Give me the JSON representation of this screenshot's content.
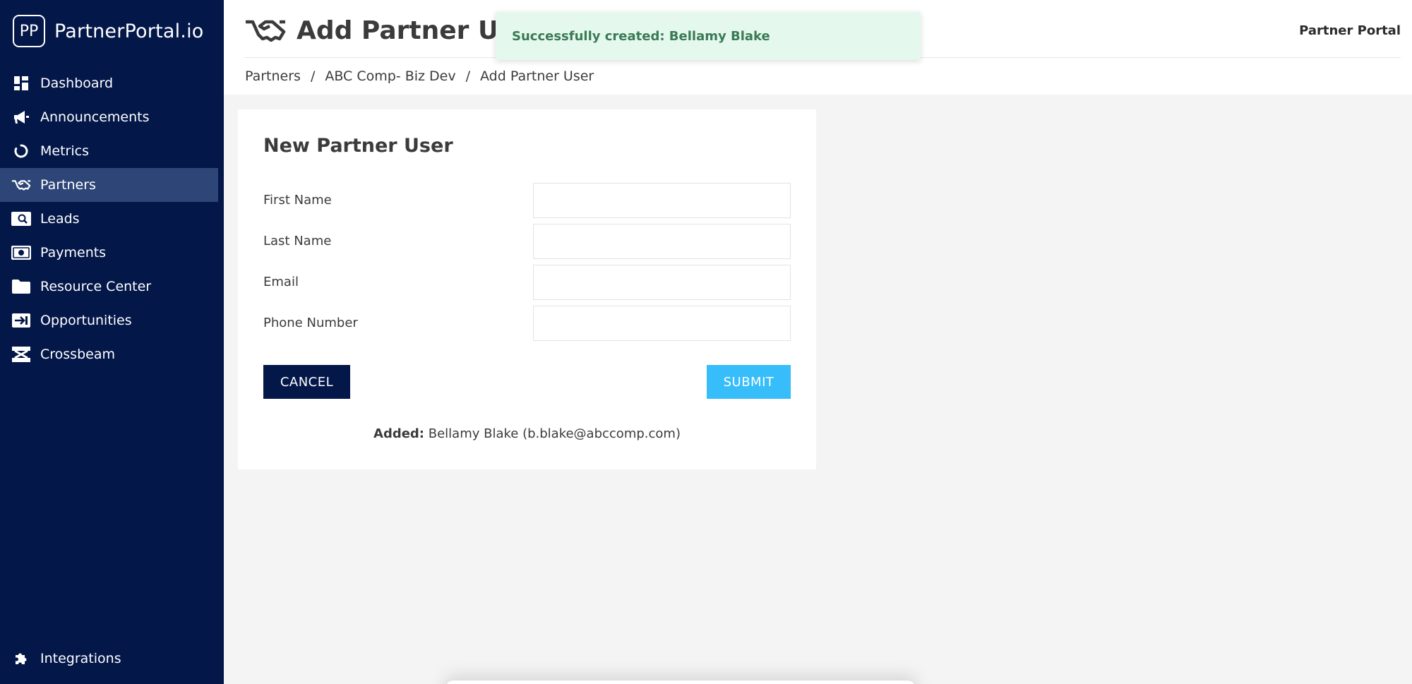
{
  "brand": {
    "logo_text": "PP",
    "name": "PartnerPortal.io"
  },
  "sidebar": {
    "items": [
      {
        "label": "Dashboard",
        "icon": "dashboard-icon"
      },
      {
        "label": "Announcements",
        "icon": "megaphone-icon"
      },
      {
        "label": "Metrics",
        "icon": "circle-notch-icon"
      },
      {
        "label": "Partners",
        "icon": "handshake-icon",
        "active": true
      },
      {
        "label": "Leads",
        "icon": "search-dollar-icon"
      },
      {
        "label": "Payments",
        "icon": "money-bill-icon"
      },
      {
        "label": "Resource Center",
        "icon": "folder-icon"
      },
      {
        "label": "Opportunities",
        "icon": "arrow-in-box-icon"
      },
      {
        "label": "Crossbeam",
        "icon": "crossbeam-icon"
      }
    ],
    "bottom_item": {
      "label": "Integrations",
      "icon": "puzzle-icon"
    }
  },
  "header": {
    "title": "Add Partner User",
    "title_icon": "handshake-icon",
    "right_label": "Partner Portal",
    "breadcrumb": [
      "Partners",
      "ABC Comp- Biz Dev",
      "Add Partner User"
    ],
    "breadcrumb_separator": "/"
  },
  "toast": {
    "message": "Successfully created: Bellamy Blake"
  },
  "form": {
    "title": "New Partner User",
    "fields": [
      {
        "label": "First Name",
        "value": "",
        "placeholder": ""
      },
      {
        "label": "Last Name",
        "value": "",
        "placeholder": ""
      },
      {
        "label": "Email",
        "value": "",
        "placeholder": ""
      },
      {
        "label": "Phone Number",
        "value": "",
        "placeholder": ""
      }
    ],
    "cancel_label": "CANCEL",
    "submit_label": "SUBMIT",
    "added_prefix": "Added:",
    "added_text": "Bellamy Blake (b.blake@abccomp.com)"
  },
  "colors": {
    "sidebar_bg": "#031749",
    "sidebar_active": "#2d4577",
    "submit_button": "#36bdfa",
    "cancel_button": "#031749",
    "toast_bg": "#e5f8ed",
    "toast_text": "#3a7a55"
  }
}
